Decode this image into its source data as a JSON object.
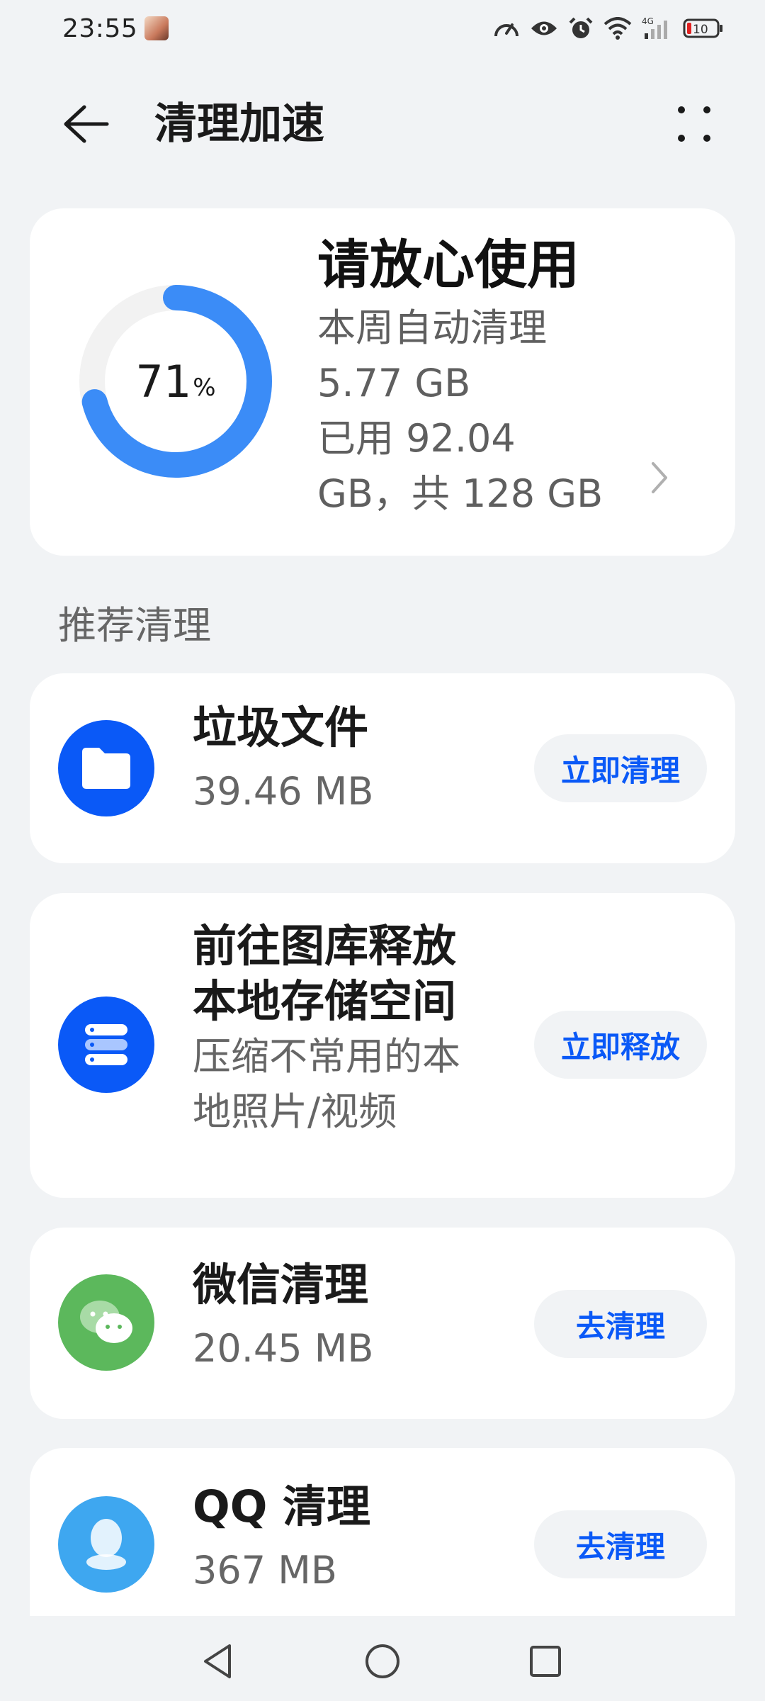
{
  "status_bar": {
    "time": "23:55",
    "network": "4G",
    "battery": "10",
    "icons": [
      "speed-icon",
      "eye-icon",
      "alarm-icon",
      "wifi-icon",
      "signal-icon",
      "battery-icon"
    ]
  },
  "header": {
    "title": "清理加速",
    "back_icon": "arrow-left-icon",
    "more_icon": "more-dots-icon"
  },
  "storage": {
    "percent": 71,
    "percent_value": "71",
    "percent_unit": "%",
    "status": "请放心使用",
    "auto_clean_label": "本周自动清理",
    "auto_clean_size": "5.77 GB",
    "used_line1": "已用 92.04",
    "used_line2": "GB，共 128 GB",
    "colors": {
      "ring": "#3b8cf7",
      "track": "#f2f2f2"
    }
  },
  "section": {
    "title": "推荐清理"
  },
  "items": [
    {
      "title": "垃圾文件",
      "subtitle": "39.46 MB",
      "action": "立即清理",
      "icon": "folder-icon",
      "color": "#0a59f7"
    },
    {
      "title_line1": "前往图库释放",
      "title_line2": "本地存储空间",
      "subtitle_line1": "压缩不常用的本",
      "subtitle_line2": "地照片/视频",
      "action": "立即释放",
      "icon": "storage-stack-icon",
      "color": "#0a59f7"
    },
    {
      "title": "微信清理",
      "subtitle": "20.45 MB",
      "action": "去清理",
      "icon": "wechat-icon",
      "color": "#5cb85c"
    },
    {
      "title": "QQ 清理",
      "subtitle": "367 MB",
      "action": "去清理",
      "icon": "qq-icon",
      "color": "#3ea7f0"
    }
  ],
  "nav": {
    "icons": [
      "back-triangle-icon",
      "home-circle-icon",
      "recents-square-icon"
    ]
  }
}
